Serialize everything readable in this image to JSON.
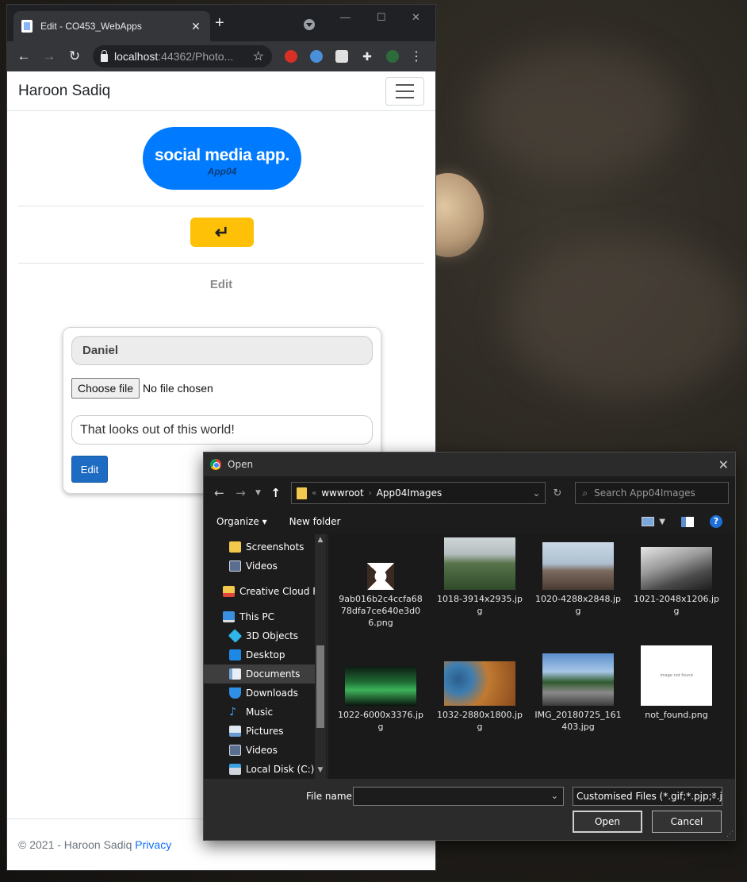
{
  "browser": {
    "tab_title": "Edit - CO453_WebApps",
    "url_host": "localhost",
    "url_rest": ":44362/Photo..."
  },
  "site": {
    "brand": "Haroon Sadiq",
    "logo_title": "social media app.",
    "logo_sub": "App04",
    "back_icon": "↵",
    "page_title": "Edit",
    "form": {
      "name_value": "Daniel",
      "choose_file_label": "Choose file",
      "no_file_text": "No file chosen",
      "caption_value": "That looks out of this world!",
      "submit_label": "Edit"
    },
    "footer": {
      "copyright": "© 2021 - Haroon Sadiq",
      "privacy_link": "Privacy"
    }
  },
  "dialog": {
    "title": "Open",
    "breadcrumb": [
      "wwwroot",
      "App04Images"
    ],
    "search_placeholder": "Search App04Images",
    "toolbar": {
      "organize": "Organize",
      "new_folder": "New folder"
    },
    "nav_items": [
      {
        "label": "Screenshots",
        "icon": "folder-icon"
      },
      {
        "label": "Videos",
        "icon": "videos-icon"
      },
      {
        "label": "Creative Cloud Fil",
        "icon": "creative-cloud-icon"
      },
      {
        "label": "This PC",
        "icon": "computer-icon"
      },
      {
        "label": "3D Objects",
        "icon": "3d-objects-icon"
      },
      {
        "label": "Desktop",
        "icon": "desktop-icon"
      },
      {
        "label": "Documents",
        "icon": "documents-icon"
      },
      {
        "label": "Downloads",
        "icon": "downloads-icon"
      },
      {
        "label": "Music",
        "icon": "music-icon"
      },
      {
        "label": "Pictures",
        "icon": "pictures-icon"
      },
      {
        "label": "Videos",
        "icon": "videos-icon"
      },
      {
        "label": "Local Disk (C:)",
        "icon": "disk-icon"
      }
    ],
    "files": [
      {
        "name": "9ab016b2c4ccfa6878dfa7ce640e3d06.png"
      },
      {
        "name": "1018-3914x2935.jpg"
      },
      {
        "name": "1020-4288x2848.jpg"
      },
      {
        "name": "1021-2048x1206.jpg"
      },
      {
        "name": "1022-6000x3376.jpg"
      },
      {
        "name": "1032-2880x1800.jpg"
      },
      {
        "name": "IMG_20180725_161403.jpg"
      },
      {
        "name": "not_found.png",
        "preview_text": "image not found"
      }
    ],
    "file_name_label": "File name:",
    "file_name_value": "",
    "filter": "Customised Files (*.gif;*.pjp;*.jpg",
    "open_label": "Open",
    "cancel_label": "Cancel"
  }
}
